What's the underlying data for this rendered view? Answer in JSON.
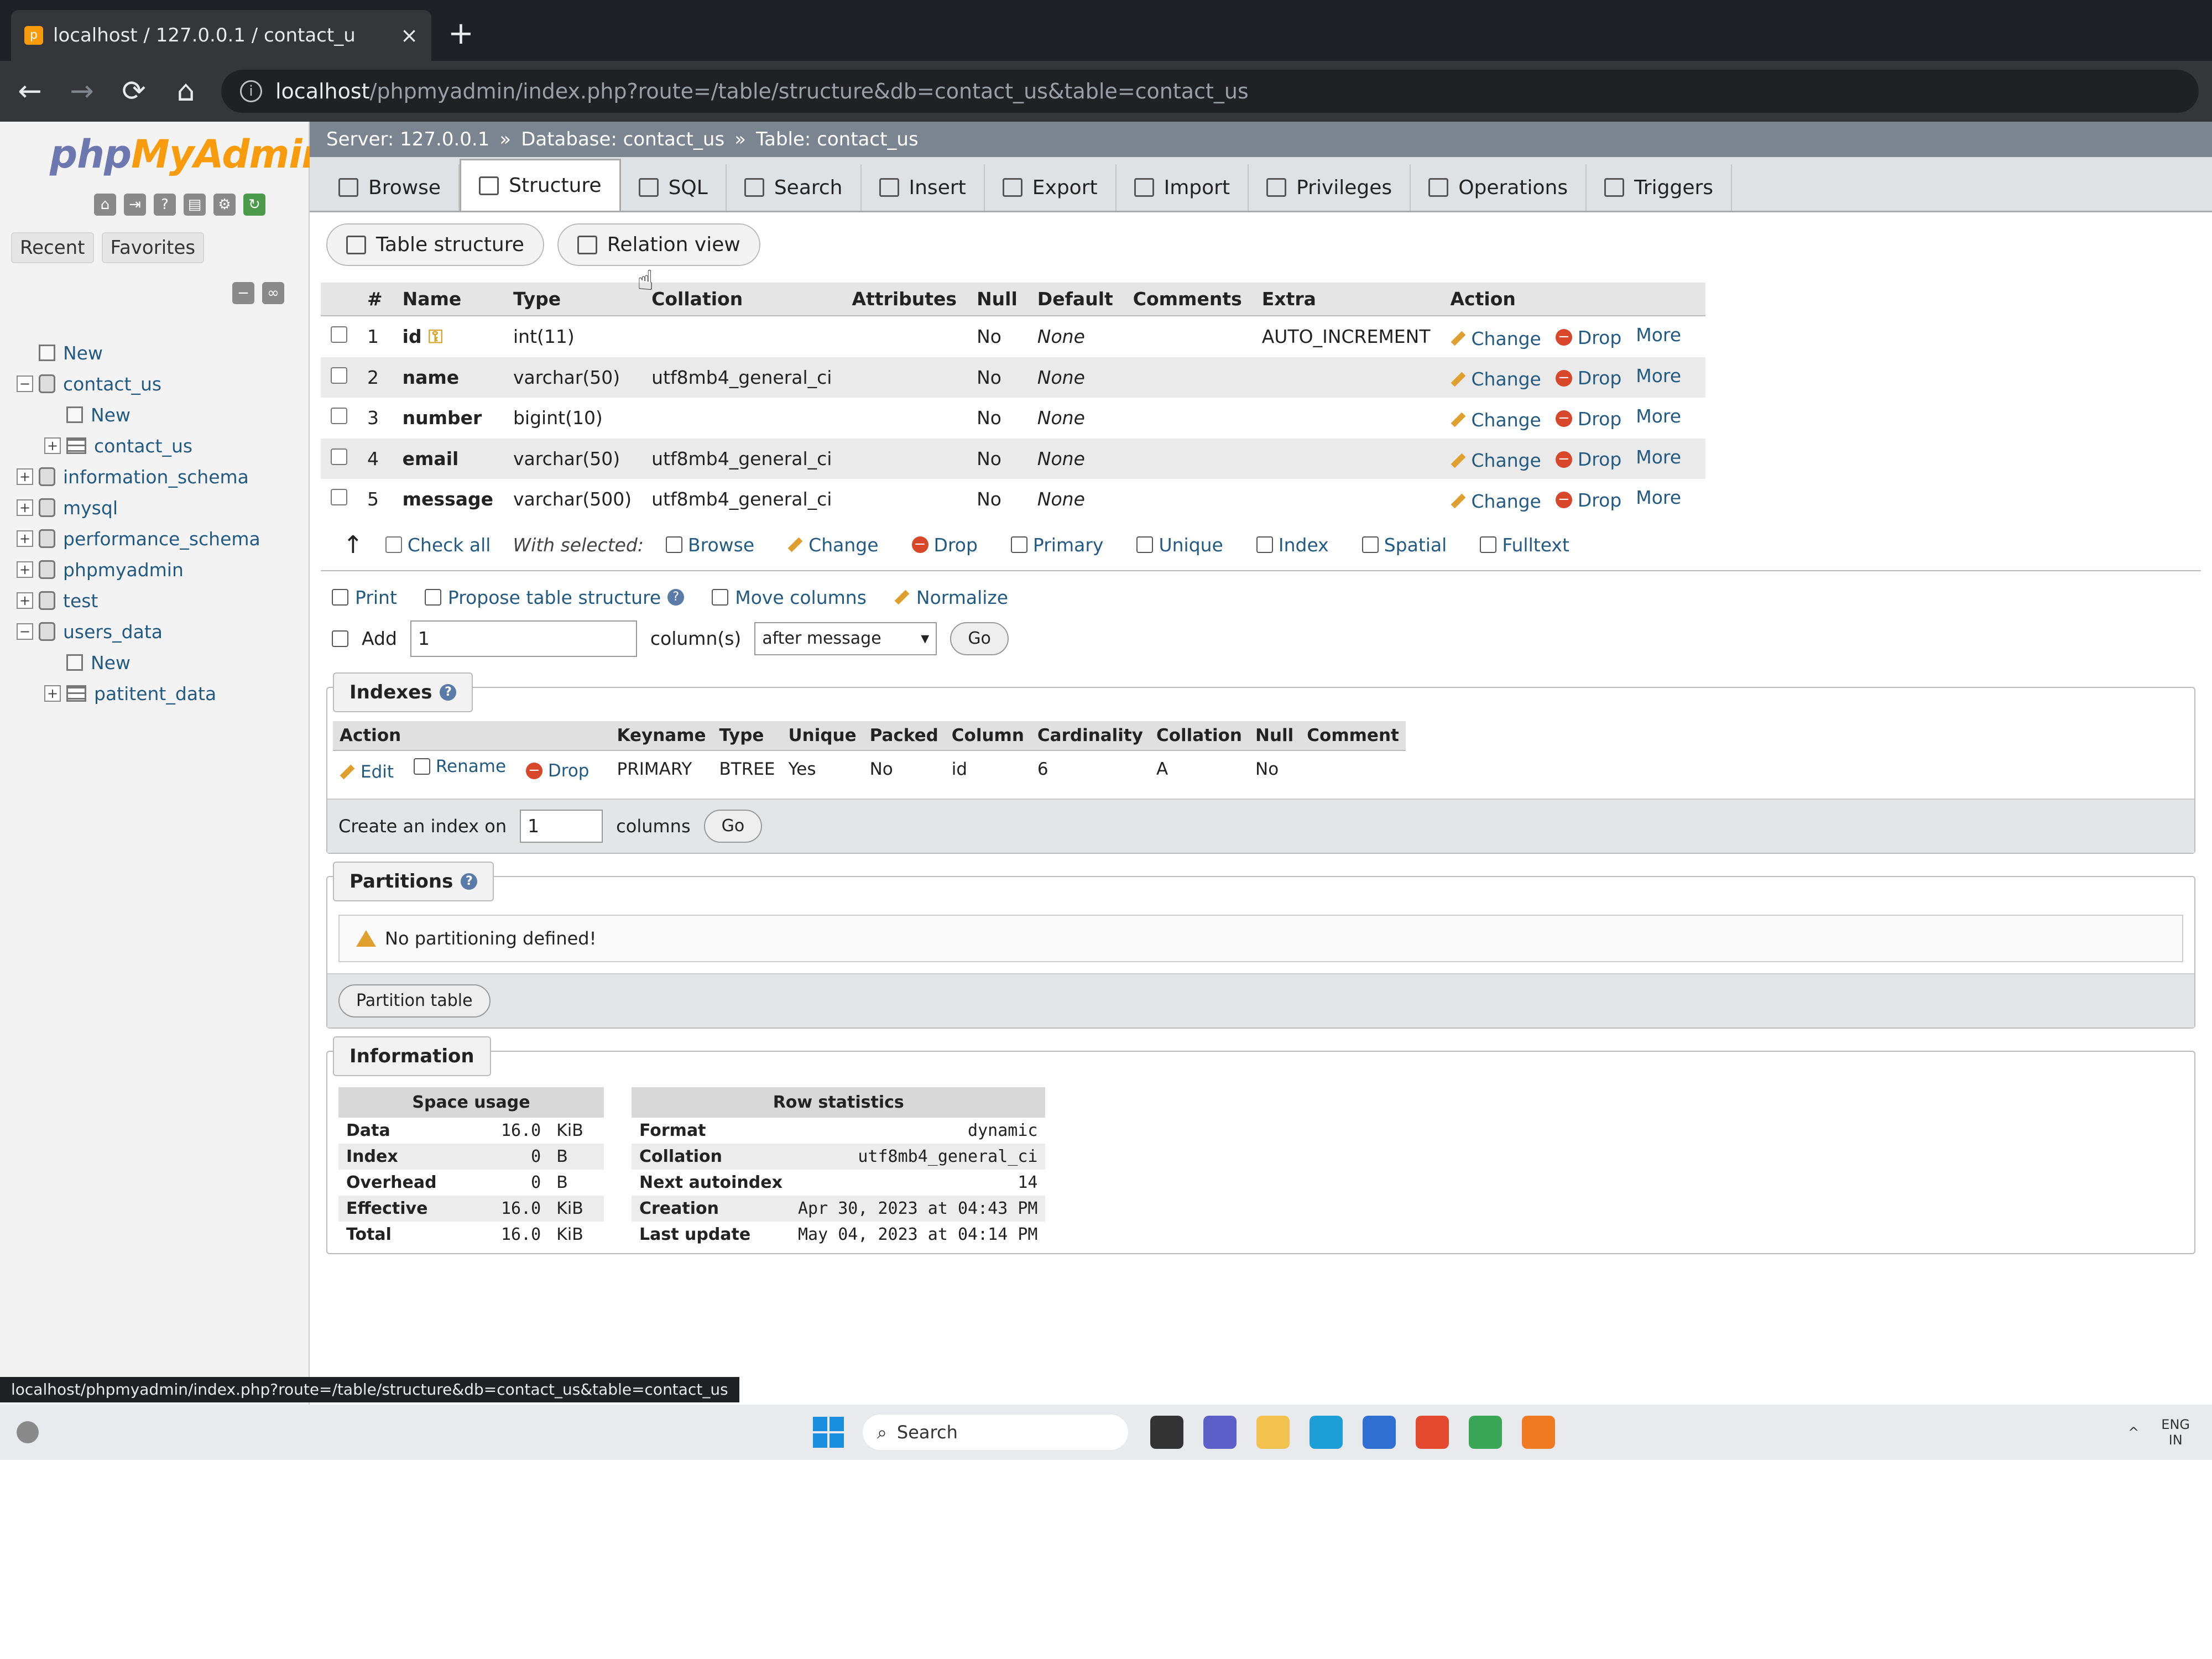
{
  "browser": {
    "tab_title": "localhost / 127.0.0.1 / contact_u",
    "tab_close": "×",
    "new_tab": "+",
    "url_host": "localhost",
    "url_path": "/phpmyadmin/index.php?route=/table/structure&db=contact_us&table=contact_us"
  },
  "sidebar": {
    "logo_php": "php",
    "logo_my": "MyAdmin",
    "tabs": [
      "Recent",
      "Favorites"
    ],
    "tree": [
      {
        "label": "New",
        "level": 0,
        "kind": "new"
      },
      {
        "label": "contact_us",
        "level": 0,
        "kind": "db",
        "exp": "−"
      },
      {
        "label": "New",
        "level": 1,
        "kind": "new"
      },
      {
        "label": "contact_us",
        "level": 1,
        "kind": "table",
        "exp": "+"
      },
      {
        "label": "information_schema",
        "level": 0,
        "kind": "db",
        "exp": "+"
      },
      {
        "label": "mysql",
        "level": 0,
        "kind": "db",
        "exp": "+"
      },
      {
        "label": "performance_schema",
        "level": 0,
        "kind": "db",
        "exp": "+"
      },
      {
        "label": "phpmyadmin",
        "level": 0,
        "kind": "db",
        "exp": "+"
      },
      {
        "label": "test",
        "level": 0,
        "kind": "db",
        "exp": "+"
      },
      {
        "label": "users_data",
        "level": 0,
        "kind": "db",
        "exp": "−"
      },
      {
        "label": "New",
        "level": 1,
        "kind": "new"
      },
      {
        "label": "patitent_data",
        "level": 1,
        "kind": "table",
        "exp": "+"
      }
    ]
  },
  "breadcrumb": {
    "server": "Server: 127.0.0.1",
    "database": "Database: contact_us",
    "table": "Table: contact_us",
    "sep": "»"
  },
  "menu_tabs": [
    "Browse",
    "Structure",
    "SQL",
    "Search",
    "Insert",
    "Export",
    "Import",
    "Privileges",
    "Operations",
    "Triggers"
  ],
  "sub_tabs": [
    "Table structure",
    "Relation view"
  ],
  "structure": {
    "headers": [
      "#",
      "Name",
      "Type",
      "Collation",
      "Attributes",
      "Null",
      "Default",
      "Comments",
      "Extra",
      "Action"
    ],
    "rows": [
      {
        "num": "1",
        "name": "id",
        "type": "int(11)",
        "collation": "",
        "attributes": "",
        "null": "No",
        "default": "None",
        "comments": "",
        "extra": "AUTO_INCREMENT"
      },
      {
        "num": "2",
        "name": "name",
        "type": "varchar(50)",
        "collation": "utf8mb4_general_ci",
        "attributes": "",
        "null": "No",
        "default": "None",
        "comments": "",
        "extra": ""
      },
      {
        "num": "3",
        "name": "number",
        "type": "bigint(10)",
        "collation": "",
        "attributes": "",
        "null": "No",
        "default": "None",
        "comments": "",
        "extra": ""
      },
      {
        "num": "4",
        "name": "email",
        "type": "varchar(50)",
        "collation": "utf8mb4_general_ci",
        "attributes": "",
        "null": "No",
        "default": "None",
        "comments": "",
        "extra": ""
      },
      {
        "num": "5",
        "name": "message",
        "type": "varchar(500)",
        "collation": "utf8mb4_general_ci",
        "attributes": "",
        "null": "No",
        "default": "None",
        "comments": "",
        "extra": ""
      }
    ],
    "actions": {
      "change": "Change",
      "drop": "Drop",
      "more": "More"
    }
  },
  "with_selected": {
    "arrow": "↑",
    "check_all": "Check all",
    "label": "With selected:",
    "buttons": [
      "Browse",
      "Change",
      "Drop",
      "Primary",
      "Unique",
      "Index",
      "Spatial",
      "Fulltext"
    ]
  },
  "tools": {
    "print": "Print",
    "propose": "Propose table structure",
    "move": "Move columns",
    "normalize": "Normalize",
    "add_label": "Add",
    "add_value": "1",
    "columns_label": "column(s)",
    "position": "after message",
    "go": "Go"
  },
  "indexes": {
    "title": "Indexes",
    "headers": [
      "Action",
      "Keyname",
      "Type",
      "Unique",
      "Packed",
      "Column",
      "Cardinality",
      "Collation",
      "Null",
      "Comment"
    ],
    "edit": "Edit",
    "rename": "Rename",
    "drop": "Drop",
    "row": {
      "keyname": "PRIMARY",
      "type": "BTREE",
      "unique": "Yes",
      "packed": "No",
      "column": "id",
      "cardinality": "6",
      "collation": "A",
      "null": "No",
      "comment": ""
    },
    "create_label": "Create an index on",
    "create_value": "1",
    "columns_label": "columns",
    "go": "Go"
  },
  "partitions": {
    "title": "Partitions",
    "notice": "No partitioning defined!",
    "button": "Partition table"
  },
  "information": {
    "title": "Information",
    "space_usage": {
      "title": "Space usage",
      "rows": [
        {
          "label": "Data",
          "value": "16.0",
          "unit": "KiB"
        },
        {
          "label": "Index",
          "value": "0",
          "unit": "B"
        },
        {
          "label": "Overhead",
          "value": "0",
          "unit": "B"
        },
        {
          "label": "Effective",
          "value": "16.0",
          "unit": "KiB"
        },
        {
          "label": "Total",
          "value": "16.0",
          "unit": "KiB"
        }
      ]
    },
    "row_statistics": {
      "title": "Row statistics",
      "rows": [
        {
          "label": "Format",
          "value": "dynamic"
        },
        {
          "label": "Collation",
          "value": "utf8mb4_general_ci"
        },
        {
          "label": "Next autoindex",
          "value": "14"
        },
        {
          "label": "Creation",
          "value": "Apr 30, 2023 at 04:43 PM"
        },
        {
          "label": "Last update",
          "value": "May 04, 2023 at 04:14 PM"
        }
      ]
    }
  },
  "status_url": "localhost/phpmyadmin/index.php?route=/table/structure&db=contact_us&table=contact_us",
  "taskbar": {
    "search": "Search",
    "lang": "ENG",
    "region": "IN",
    "apps": [
      {
        "name": "task-view-icon",
        "color": "#333333"
      },
      {
        "name": "teams-icon",
        "color": "#5b5fc7"
      },
      {
        "name": "file-explorer-icon",
        "color": "#f2c14e"
      },
      {
        "name": "edge-icon",
        "color": "#1d9fd8"
      },
      {
        "name": "store-icon",
        "color": "#2f6fd1"
      },
      {
        "name": "brave-icon",
        "color": "#e2492f"
      },
      {
        "name": "chrome-icon",
        "color": "#3aa757"
      },
      {
        "name": "xampp-icon",
        "color": "#f07a22"
      }
    ]
  }
}
